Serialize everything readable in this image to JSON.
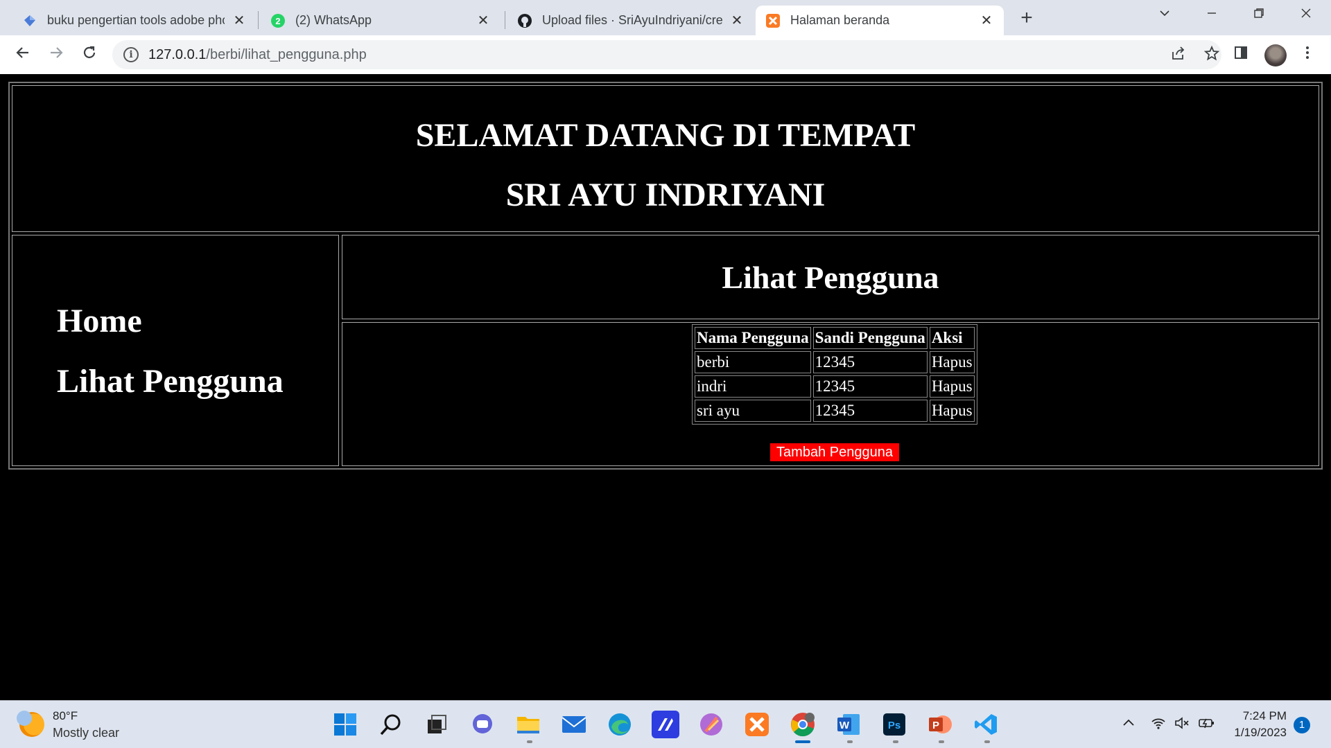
{
  "browser": {
    "tabs": [
      {
        "title": "buku pengertian tools adobe pho",
        "favicon": "diamond-icon",
        "active": false
      },
      {
        "title": "(2) WhatsApp",
        "favicon": "whatsapp-icon",
        "badge": "2",
        "active": false
      },
      {
        "title": "Upload files · SriAyuIndriyani/cre",
        "favicon": "github-icon",
        "active": false
      },
      {
        "title": "Halaman beranda",
        "favicon": "xampp-icon",
        "active": true
      }
    ],
    "close_glyph": "✕",
    "new_tab_glyph": "+",
    "url_host": "127.0.0.1",
    "url_path": "/berbi/lihat_pengguna.php",
    "info_glyph": "i"
  },
  "page": {
    "header_line1": "SELAMAT DATANG DI TEMPAT",
    "header_line2": "SRI AYU INDRIYANI",
    "menu": [
      {
        "label": "Home"
      },
      {
        "label": "Lihat Pengguna"
      }
    ],
    "section_title": "Lihat Pengguna",
    "table": {
      "headers": [
        "Nama Pengguna",
        "Sandi Pengguna",
        "Aksi"
      ],
      "rows": [
        [
          "berbi",
          "12345",
          "Hapus"
        ],
        [
          "indri",
          "12345",
          "Hapus"
        ],
        [
          "sri ayu",
          "12345",
          "Hapus"
        ]
      ]
    },
    "add_button": "Tambah Pengguna",
    "add_button_color": "#ff0000"
  },
  "taskbar": {
    "weather_temp": "80°F",
    "weather_condition": "Mostly clear",
    "apps": [
      "windows-start-icon",
      "search-icon",
      "task-view-icon",
      "chat-icon",
      "file-explorer-icon",
      "mail-icon",
      "edge-icon",
      "stylus-app-icon",
      "feather-app-icon",
      "xampp-icon",
      "chrome-icon",
      "word-icon",
      "photoshop-icon",
      "powerpoint-icon",
      "vscode-icon"
    ],
    "time": "7:24 PM",
    "date": "1/19/2023",
    "notification_count": "1"
  }
}
